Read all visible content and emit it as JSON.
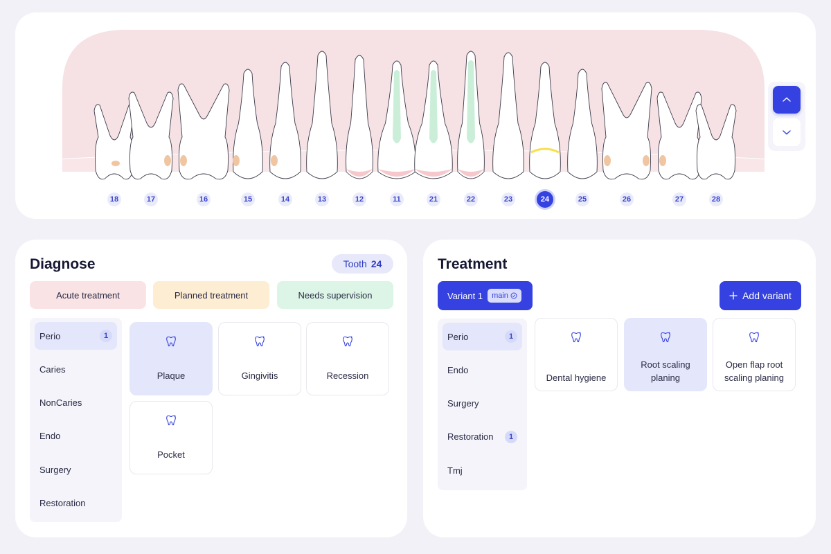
{
  "teeth": [
    {
      "id": "tooth-18",
      "number": "18"
    },
    {
      "id": "tooth-17",
      "number": "17"
    },
    {
      "id": "tooth-16",
      "number": "16"
    },
    {
      "id": "tooth-15",
      "number": "15"
    },
    {
      "id": "tooth-14",
      "number": "14"
    },
    {
      "id": "tooth-13",
      "number": "13"
    },
    {
      "id": "tooth-12",
      "number": "12"
    },
    {
      "id": "tooth-11",
      "number": "11"
    },
    {
      "id": "tooth-21",
      "number": "21"
    },
    {
      "id": "tooth-22",
      "number": "22"
    },
    {
      "id": "tooth-23",
      "number": "23"
    },
    {
      "id": "tooth-24",
      "number": "24",
      "selected": true
    },
    {
      "id": "tooth-25",
      "number": "25"
    },
    {
      "id": "tooth-26",
      "number": "26"
    },
    {
      "id": "tooth-27",
      "number": "27"
    },
    {
      "id": "tooth-28",
      "number": "28"
    }
  ],
  "diagnose": {
    "title": "Diagnose",
    "tooth_label": "Tooth",
    "tooth_value": "24",
    "legend": {
      "acute": "Acute treatment",
      "planned": "Planned treatment",
      "supervision": "Needs supervision"
    },
    "categories": [
      {
        "label": "Perio",
        "count": "1",
        "active": true
      },
      {
        "label": "Caries"
      },
      {
        "label": "NonCaries"
      },
      {
        "label": "Endo"
      },
      {
        "label": "Surgery"
      },
      {
        "label": "Restoration"
      }
    ],
    "options": [
      {
        "label": "Plaque",
        "selected": true
      },
      {
        "label": "Gingivitis"
      },
      {
        "label": "Recession"
      },
      {
        "label": "Pocket"
      }
    ]
  },
  "treatment": {
    "title": "Treatment",
    "variant_label": "Variant 1",
    "variant_tag": "main",
    "add_variant_label": "Add variant",
    "categories": [
      {
        "label": "Perio",
        "count": "1",
        "active": true
      },
      {
        "label": "Endo"
      },
      {
        "label": "Surgery"
      },
      {
        "label": "Restoration",
        "count": "1"
      },
      {
        "label": "Tmj"
      }
    ],
    "options": [
      {
        "label": "Dental hygiene"
      },
      {
        "label": "Root scaling planing",
        "selected": true
      },
      {
        "label": "Open flap root scaling planing"
      }
    ]
  },
  "colors": {
    "accent": "#3541e0",
    "gum": "#f6e1e4",
    "acute": "#fae3e5",
    "planned": "#fdedd3",
    "supervision": "#dcf5e6",
    "root_canal": "#cbeed9",
    "caries": "#f0c6a2",
    "restoration": "#f6c7cb",
    "crown_marker": "#f7e04e"
  },
  "icons": {
    "nav_up": "chevron-up-icon",
    "nav_down": "chevron-down-icon",
    "option": "tooth-icon",
    "verified": "check-circle-icon",
    "add": "plus-icon"
  }
}
